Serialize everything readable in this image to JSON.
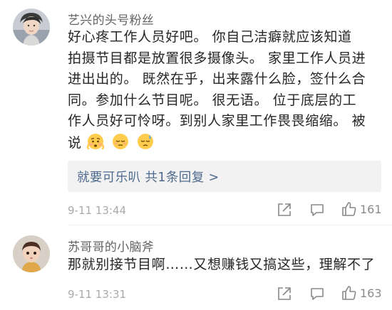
{
  "comments": [
    {
      "username": "艺兴的头号粉丝",
      "lines": [
        "好心疼工作人员好吧。  你自己洁癖就应该知道",
        "拍摄节目都是放置很多摄像头。 家里工作人员进",
        "进出出的。  既然在乎，出来露什么脸，签什么合",
        "同。参加什么节目呢。  很无语。  位于底层的工",
        "作人员好可怜呀。到别人家里工作畏畏缩缩。  被",
        "说"
      ],
      "emojis": [
        "worried-face-icon",
        "sleepy-face-icon",
        "sad-sweat-face-icon"
      ],
      "reply_summary": "就要可乐叭  共1条回复 >",
      "timestamp": "9-11 13:44",
      "likes": "161"
    },
    {
      "username": "苏哥哥的小脑斧",
      "lines": [
        "那就别接节目啊……又想赚钱又搞这些，理解不了"
      ],
      "timestamp": "9-11 13:31",
      "likes": "163"
    }
  ],
  "colors": {
    "username": "#636363",
    "text": "#262626",
    "link": "#4d6a8e",
    "meta": "#aaaaaa",
    "reply_bg": "#f2f2f2"
  }
}
